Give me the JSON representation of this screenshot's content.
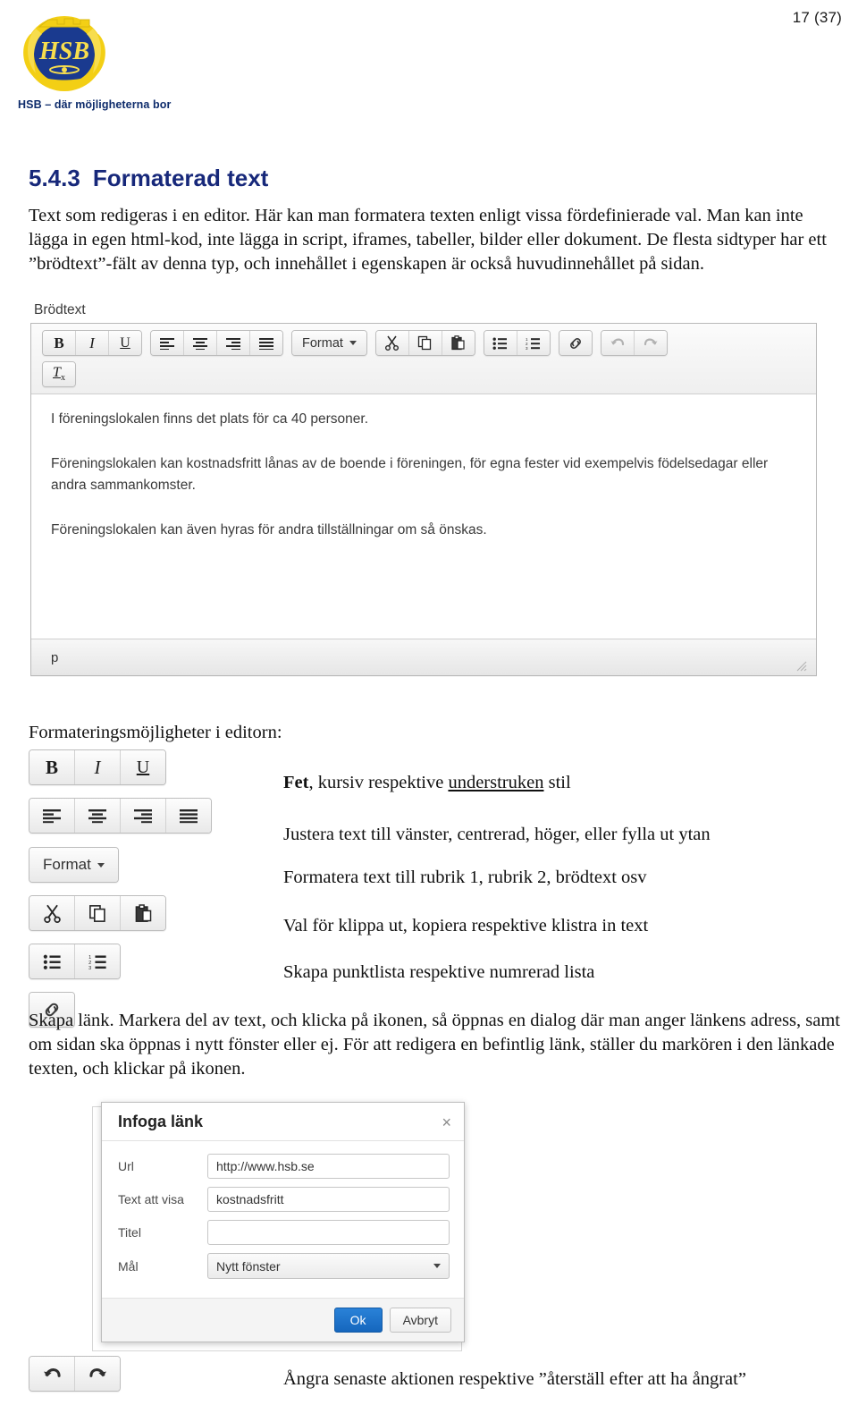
{
  "header": {
    "page_number": "17 (37)",
    "logo_tagline": "HSB – där möjligheterna bor",
    "logo_wordmark": "HSB"
  },
  "section": {
    "number": "5.4.3",
    "title": "Formaterad text",
    "intro_paragraph": "Text som redigeras i en editor. Här kan man formatera texten enligt vissa fördefinierade val. Man kan inte lägga in egen html-kod, inte lägga in script, iframes, tabeller, bilder eller dokument. De flesta sidtyper har ett ”brödtext”-fält av denna typ, och innehållet i egenskapen är också huvudinnehållet på sidan."
  },
  "editor": {
    "field_label": "Brödtext",
    "toolbar": {
      "bold": "B",
      "italic": "I",
      "underline": "U",
      "align_left": "align-left",
      "align_center": "align-center",
      "align_right": "align-right",
      "align_justify": "align-justify",
      "format_label": "Format",
      "cut": "cut",
      "copy": "copy",
      "paste": "paste",
      "bullet_list": "bullet-list",
      "numbered_list": "numbered-list",
      "link": "link",
      "undo": "undo",
      "redo": "redo",
      "remove_format": "T",
      "remove_format_sub": "x"
    },
    "content_paragraphs": [
      "I föreningslokalen finns det plats för ca 40 personer.",
      "Föreningslokalen kan kostnadsfritt lånas av de boende i föreningen, för egna fester vid exempelvis födelsedagar eller andra sammankomster.",
      "Föreningslokalen kan även hyras för andra tillställningar om så önskas."
    ],
    "status_path": "p"
  },
  "legend": {
    "intro": "Formateringsmöjligheter i editorn:",
    "rows": [
      {
        "desc_pre": "Fet",
        "desc_mid": ", kursiv respektive ",
        "desc_underlined": "understruken",
        "desc_post": " stil"
      },
      {
        "desc": "Justera text till vänster, centrerad, höger, eller fylla ut ytan"
      },
      {
        "desc": "Formatera text till rubrik 1, rubrik 2, brödtext osv"
      },
      {
        "desc": "Val för klippa ut, kopiera respektive klistra in text"
      },
      {
        "desc": "Skapa punktlista respektive numrerad lista"
      }
    ],
    "format_button_label": "Format",
    "link_paragraph": "Skapa länk. Markera del av text, och klicka på ikonen, så öppnas en dialog där man anger länkens adress, samt om sidan ska öppnas i nytt fönster eller ej. För att redigera en befintlig länk, ställer du markören i den länkade texten, och klickar på ikonen.",
    "undo_desc": "Ångra senaste aktionen respektive ”återställ efter att ha ångrat”"
  },
  "dialog": {
    "title": "Infoga länk",
    "close": "×",
    "fields": [
      {
        "label": "Url",
        "value": "http://www.hsb.se",
        "type": "input"
      },
      {
        "label": "Text att visa",
        "value": "kostnadsfritt",
        "type": "input"
      },
      {
        "label": "Titel",
        "value": "",
        "type": "input"
      },
      {
        "label": "Mål",
        "value": "Nytt fönster",
        "type": "select"
      }
    ],
    "ok_label": "Ok",
    "cancel_label": "Avbryt"
  },
  "colors": {
    "heading_blue": "#17287a",
    "logo_gold": "#f5d016",
    "logo_blue": "#1a3a8f",
    "primary_button": "#1566bd"
  }
}
